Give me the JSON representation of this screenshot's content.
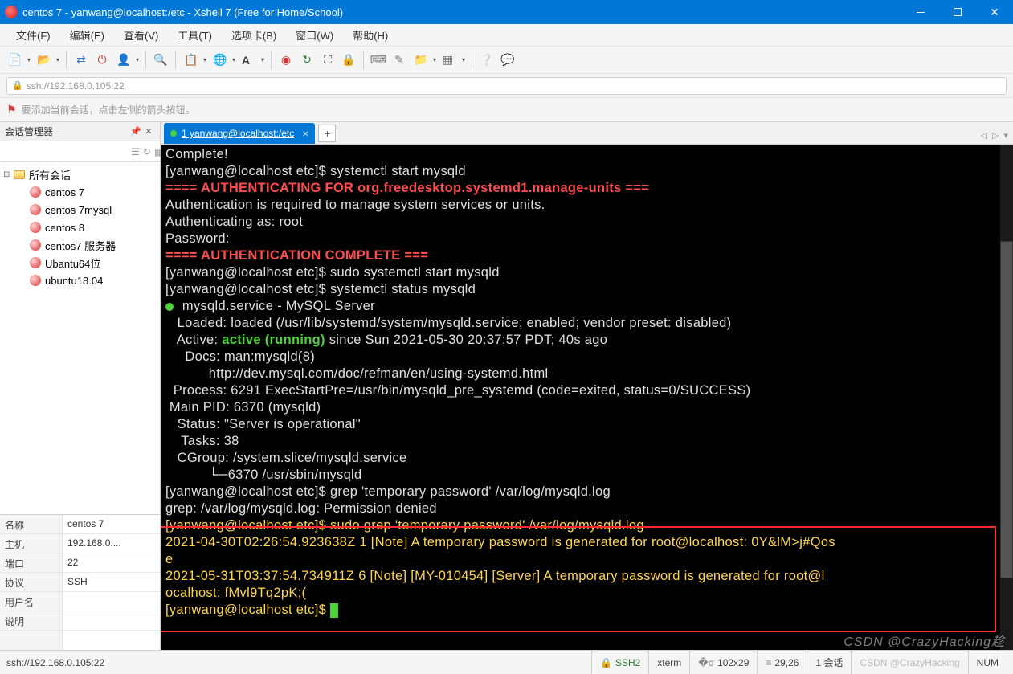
{
  "window": {
    "title": "centos 7 - yanwang@localhost:/etc - Xshell 7 (Free for Home/School)"
  },
  "menu": {
    "items": [
      "文件(F)",
      "编辑(E)",
      "查看(V)",
      "工具(T)",
      "选项卡(B)",
      "窗口(W)",
      "帮助(H)"
    ]
  },
  "addressbar": {
    "url": "ssh://192.168.0.105:22"
  },
  "hint": {
    "text": "要添加当前会话，点击左侧的箭头按钮。"
  },
  "sidebar": {
    "title": "会话管理器",
    "root": "所有会话",
    "sessions": [
      "centos 7",
      "centos 7mysql",
      "centos 8",
      "centos7 服务器",
      "Ubantu64位",
      "ubuntu18.04"
    ]
  },
  "properties": {
    "rows": [
      {
        "k": "名称",
        "v": "centos 7"
      },
      {
        "k": "主机",
        "v": "192.168.0...."
      },
      {
        "k": "端口",
        "v": "22"
      },
      {
        "k": "协议",
        "v": "SSH"
      },
      {
        "k": "用户名",
        "v": ""
      },
      {
        "k": "说明",
        "v": ""
      }
    ]
  },
  "tab": {
    "label": "1 yanwang@localhost:/etc"
  },
  "terminal": {
    "lines": [
      {
        "cls": "",
        "t": ""
      },
      {
        "cls": "c-white",
        "t": "Complete!"
      },
      {
        "cls": "c-white",
        "t": "[yanwang@localhost etc]$ systemctl start mysqld"
      },
      {
        "cls": "c-red",
        "t": "==== AUTHENTICATING FOR org.freedesktop.systemd1.manage-units ==="
      },
      {
        "cls": "c-white",
        "t": "Authentication is required to manage system services or units."
      },
      {
        "cls": "c-white",
        "t": "Authenticating as: root"
      },
      {
        "cls": "c-white",
        "t": "Password:"
      },
      {
        "cls": "c-red",
        "t": "==== AUTHENTICATION COMPLETE ==="
      },
      {
        "cls": "c-white",
        "t": "[yanwang@localhost etc]$ sudo systemctl start mysqld"
      },
      {
        "cls": "c-white",
        "t": "[yanwang@localhost etc]$ systemctl status mysqld"
      }
    ],
    "status_block": {
      "head": " mysqld.service - MySQL Server",
      "loaded": "   Loaded: loaded (/usr/lib/systemd/system/mysqld.service; enabled; vendor preset: disabled)",
      "active_pre": "   Active: ",
      "active_state": "active (running)",
      "active_post": " since Sun 2021-05-30 20:37:57 PDT; 40s ago",
      "docs1": "     Docs: man:mysqld(8)",
      "docs2": "           http://dev.mysql.com/doc/refman/en/using-systemd.html",
      "process": "  Process: 6291 ExecStartPre=/usr/bin/mysqld_pre_systemd (code=exited, status=0/SUCCESS)",
      "mainpid": " Main PID: 6370 (mysqld)",
      "statusln": "   Status: \"Server is operational\"",
      "tasks": "    Tasks: 38",
      "cgroup": "   CGroup: /system.slice/mysqld.service",
      "cgroup2": "           └─6370 /usr/sbin/mysqld"
    },
    "tail": [
      "[yanwang@localhost etc]$ grep 'temporary password' /var/log/mysqld.log",
      "grep: /var/log/mysqld.log: Permission denied",
      "[yanwang@localhost etc]$ sudo grep 'temporary password' /var/log/mysqld.log",
      "2021-04-30T02:26:54.923638Z 1 [Note] A temporary password is generated for root@localhost: 0Y&lM>j#Qos",
      "e",
      "2021-05-31T03:37:54.734911Z 6 [Note] [MY-010454] [Server] A temporary password is generated for root@l",
      "ocalhost: fMvl9Tq2pK;(",
      "[yanwang@localhost etc]$ "
    ]
  },
  "statusbar": {
    "left": "ssh://192.168.0.105:22",
    "proto": "SSH2",
    "term": "xterm",
    "size": "102x29",
    "cursor": "29,26",
    "sessions": "1 会话",
    "caps_pre": "CSDN @CrazyHacking",
    "num": "NUM"
  },
  "watermark": "CSDN @CrazyHacking趁"
}
